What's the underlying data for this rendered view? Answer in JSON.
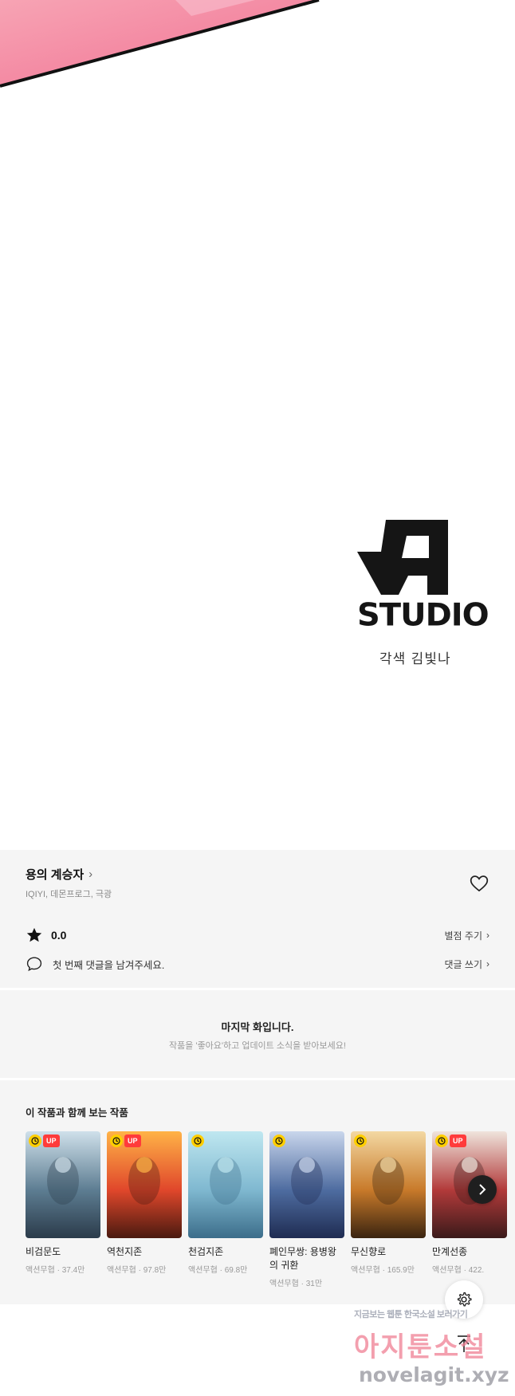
{
  "panel": {
    "studio_logo_text": "STUDIO",
    "credit": "각색 김빛나"
  },
  "series": {
    "title": "용의 계승자",
    "authors": "IQIYI, 데몬프로그, 극광",
    "rating": "0.0",
    "rate_link": "별점 주기",
    "comment_prompt": "첫 번째 댓글을 남겨주세요.",
    "comment_link": "댓글 쓰기"
  },
  "last_episode": {
    "title": "마지막 화입니다.",
    "subtitle": "작품을 '좋아요'하고 업데이트 소식을 받아보세요!"
  },
  "recommendations": {
    "heading": "이 작품과 함께 보는 작품",
    "items": [
      {
        "name": "비검문도",
        "genre": "액션무협",
        "views": "37.4만",
        "badge_up": true,
        "cover_colors": [
          "#cfe0ea",
          "#5d7d92",
          "#2b3b4a"
        ]
      },
      {
        "name": "역천지존",
        "genre": "액션무협",
        "views": "97.8만",
        "badge_up": true,
        "cover_colors": [
          "#ffb347",
          "#e0472b",
          "#4a1a10"
        ]
      },
      {
        "name": "천검지존",
        "genre": "액션무협",
        "views": "69.8만",
        "badge_up": false,
        "cover_colors": [
          "#bfe7f0",
          "#7fb8d0",
          "#3c6d8a"
        ]
      },
      {
        "name": "폐인무쌍: 용병왕의 귀환",
        "genre": "액션무협",
        "views": "31만",
        "badge_up": false,
        "cover_colors": [
          "#c9d6ec",
          "#4e6ca0",
          "#1f2c52"
        ]
      },
      {
        "name": "무신향로",
        "genre": "액션무협",
        "views": "165.9만",
        "badge_up": false,
        "cover_colors": [
          "#f3d8a2",
          "#c87a2a",
          "#3a2410"
        ]
      },
      {
        "name": "만계선종",
        "genre": "액션무협",
        "views": "422.",
        "badge_up": true,
        "cover_colors": [
          "#efe4dc",
          "#b23a3a",
          "#3a1a1a"
        ]
      }
    ]
  },
  "watermark": {
    "top_line": "지금보는 웹툰 한국소설 보러가기",
    "big": "아지툰소설",
    "url": "novelagit.xyz"
  },
  "colors": {
    "section_bg": "#f5f5f5",
    "badge_up": "#ff3b3b",
    "badge_clock": "#ffce00"
  }
}
